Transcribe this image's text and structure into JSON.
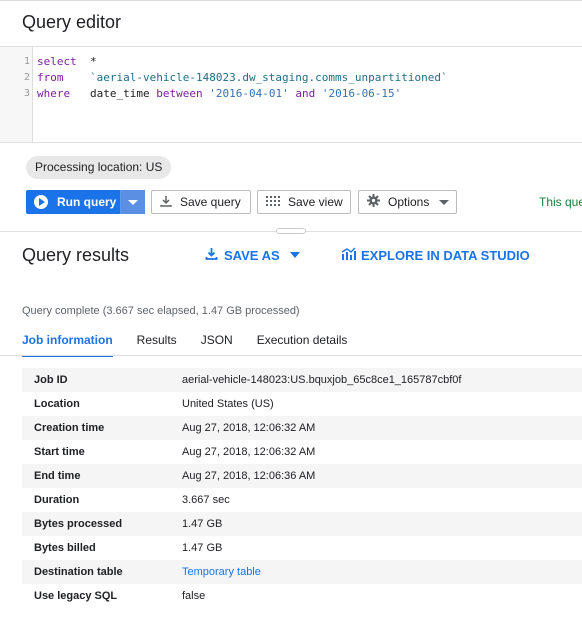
{
  "editor": {
    "title": "Query editor",
    "line_numbers": [
      "1",
      "2",
      "3"
    ],
    "lines": [
      {
        "kw": "select",
        "rest": "*"
      },
      {
        "kw": "from",
        "rest": "`aerial-vehicle-148023.dw_staging.comms_unpartitioned`"
      },
      {
        "kw": "where",
        "col": "date_time",
        "kw2": "between",
        "v1": "'2016-04-01'",
        "kw3": "and",
        "v2": "'2016-06-15'"
      }
    ]
  },
  "processing_location": "Processing location: US",
  "toolbar": {
    "run_label": "Run query",
    "save_query_label": "Save query",
    "save_view_label": "Save view",
    "options_label": "Options",
    "status_text": "This query"
  },
  "results": {
    "title": "Query results",
    "save_as_label": "SAVE AS",
    "explore_label": "EXPLORE IN DATA STUDIO",
    "complete_text": "Query complete (3.667 sec elapsed, 1.47 GB processed)",
    "tabs": [
      "Job information",
      "Results",
      "JSON",
      "Execution details"
    ],
    "active_tab": "Job information"
  },
  "job_info": [
    {
      "key": "Job ID",
      "value": "aerial-vehicle-148023:US.bquxjob_65c8ce1_165787cbf0f"
    },
    {
      "key": "Location",
      "value": "United States (US)"
    },
    {
      "key": "Creation time",
      "value": "Aug 27, 2018, 12:06:32 AM"
    },
    {
      "key": "Start time",
      "value": "Aug 27, 2018, 12:06:32 AM"
    },
    {
      "key": "End time",
      "value": "Aug 27, 2018, 12:06:36 AM"
    },
    {
      "key": "Duration",
      "value": "3.667 sec"
    },
    {
      "key": "Bytes processed",
      "value": "1.47 GB"
    },
    {
      "key": "Bytes billed",
      "value": "1.47 GB"
    },
    {
      "key": "Destination table",
      "value": "Temporary table"
    },
    {
      "key": "Use legacy SQL",
      "value": "false"
    }
  ],
  "colors": {
    "accent": "#1a73e8",
    "success": "#188038",
    "keyword": "#7b1fa2",
    "string": "#3770b0"
  }
}
